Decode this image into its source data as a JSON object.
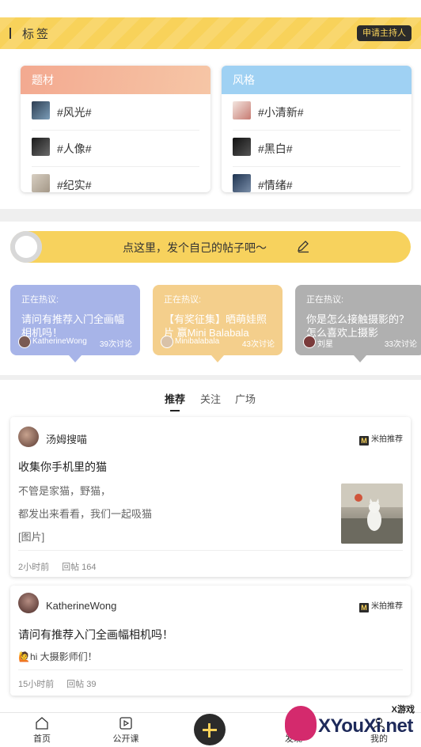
{
  "header": {
    "title": "标签",
    "apply_label": "申请主持人"
  },
  "categories": [
    {
      "name": "题材",
      "tags": [
        "#风光#",
        "#人像#",
        "#纪实#"
      ]
    },
    {
      "name": "风格",
      "tags": [
        "#小清新#",
        "#黑白#",
        "#情绪#"
      ]
    }
  ],
  "post_prompt": {
    "text": "点这里，发个自己的帖子吧～"
  },
  "hot_topics": [
    {
      "label": "正在热议:",
      "title": "请问有推荐入门全画幅相机吗！",
      "user": "KatherineWong",
      "count": "39次讨论",
      "color": "#a7b4e8"
    },
    {
      "label": "正在热议:",
      "title": "【有奖征集】晒萌娃照片 赢Mini Balabala",
      "user": "Minibalabala",
      "count": "43次讨论",
      "color": "#f4cf8c"
    },
    {
      "label": "正在热议:",
      "title": "你是怎么接触摄影的？怎么喜欢上摄影",
      "user": "刘星",
      "count": "33次讨论",
      "color": "#b0b0b0"
    }
  ],
  "tabs": [
    "推荐",
    "关注",
    "广场"
  ],
  "feed": [
    {
      "user": "汤姆搜喵",
      "badge": "米拍推荐",
      "title": "收集你手机里的猫",
      "lines": [
        "不管是家猫，野猫，",
        "都发出来看看，我们一起吸猫",
        "[图片]"
      ],
      "time": "2小时前",
      "replies": "回帖 164"
    },
    {
      "user": "KatherineWong",
      "badge": "米拍推荐",
      "title": "请问有推荐入门全画幅相机吗！",
      "lines": [
        "🙋hi 大摄影师们！"
      ],
      "time": "15小时前",
      "replies": "回帖 39"
    }
  ],
  "bottom_nav": {
    "home": "首页",
    "course": "公开课",
    "discover": "发现",
    "mine": "我的"
  },
  "watermark": {
    "small": "X游戏",
    "big": "XYouXi.net"
  },
  "colors": {
    "brand_yellow": "#f8d25a",
    "dark": "#2b2b2b"
  }
}
